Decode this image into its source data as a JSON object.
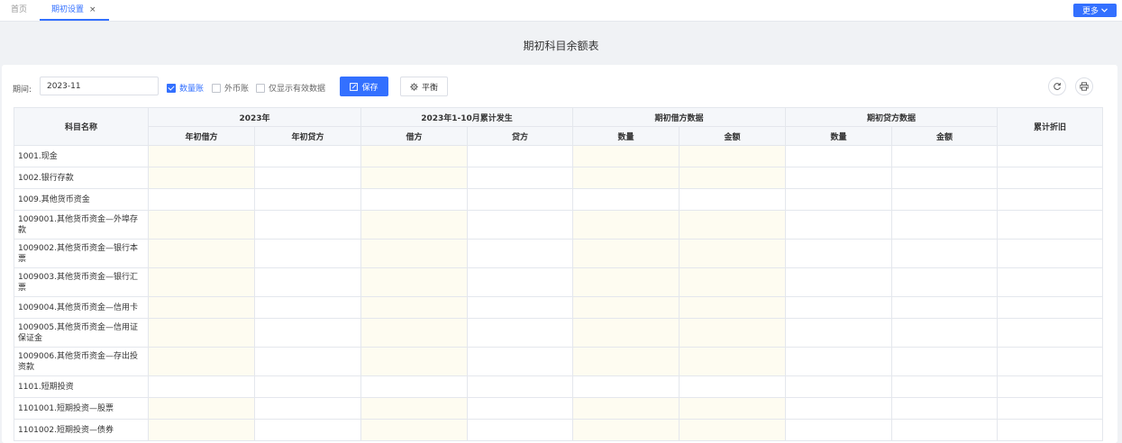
{
  "tabs": {
    "home": "首页",
    "active": "期初设置",
    "close": "×"
  },
  "more_button": "更多",
  "page_title": "期初科目余额表",
  "toolbar": {
    "period_label": "期间:",
    "period_value": "2023-11",
    "checkboxes": [
      {
        "label": "数量账",
        "checked": true
      },
      {
        "label": "外币账",
        "checked": false
      },
      {
        "label": "仅显示有效数据",
        "checked": false
      }
    ],
    "save_label": "保存",
    "balance_label": "平衡"
  },
  "table": {
    "col_subject": "科目名称",
    "group_2023": "2023年",
    "group_cumulative": "2023年1-10月累计发生",
    "group_debit_data": "期初借方数据",
    "group_credit_data": "期初贷方数据",
    "col_depreciation": "累计折旧",
    "sub_year_debit": "年初借方",
    "sub_year_credit": "年初贷方",
    "sub_debit": "借方",
    "sub_credit": "贷方",
    "sub_qty_1": "数量",
    "sub_amount_1": "金额",
    "sub_qty_2": "数量",
    "sub_amount_2": "金额",
    "rows": [
      "1001.现金",
      "1002.银行存款",
      "1009.其他货币资金",
      "1009001.其他货币资金—外埠存款",
      "1009002.其他货币资金—银行本票",
      "1009003.其他货币资金—银行汇票",
      "1009004.其他货币资金—信用卡",
      "1009005.其他货币资金—信用证保证金",
      "1009006.其他货币资金—存出投资款",
      "1101.短期投资",
      "1101001.短期投资—股票",
      "1101002.短期投资—债券"
    ]
  },
  "colors": {
    "accent": "#3370ff",
    "editable_cell": "#fefcf1",
    "header_bg": "#f5f7fa"
  }
}
